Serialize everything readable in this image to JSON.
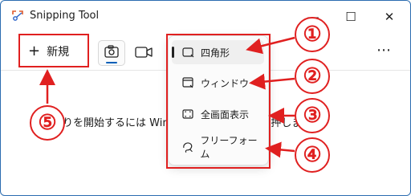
{
  "window": {
    "title": "Snipping Tool"
  },
  "titlebar_buttons": {
    "minimize": "—",
    "maximize": "☐",
    "close": "✕"
  },
  "toolbar": {
    "new_label": "新規",
    "more": "⋯",
    "active_mode": "camera-icon"
  },
  "menu": {
    "items": [
      {
        "label": "四角形",
        "icon": "rectangle-snip-icon",
        "selected": true
      },
      {
        "label": "ウィンドウ",
        "icon": "window-snip-icon",
        "selected": false
      },
      {
        "label": "全画面表示",
        "icon": "fullscreen-snip-icon",
        "selected": false
      },
      {
        "label": "フリーフォーム",
        "icon": "freeform-snip-icon",
        "selected": false
      }
    ]
  },
  "hint": {
    "text": "切り取りを開始するには Windows + Shift + S を押します"
  },
  "callouts": [
    "①",
    "②",
    "③",
    "④",
    "⑤"
  ],
  "colors": {
    "annotation": "#e02020",
    "accent": "#005fb8"
  }
}
